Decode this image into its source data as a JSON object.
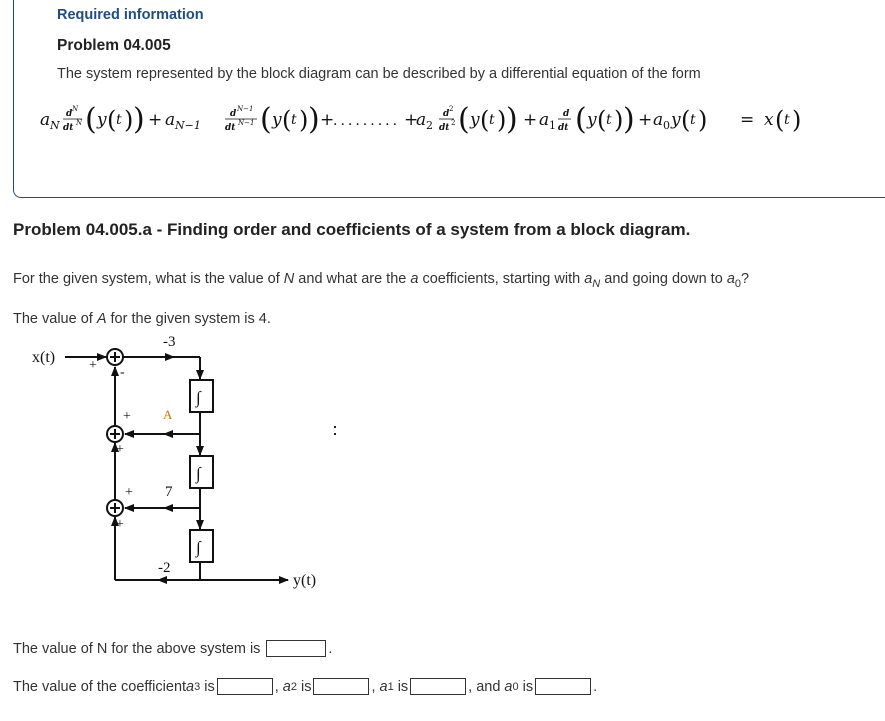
{
  "header": {
    "required_info": "Required information",
    "problem_title": "Problem 04.005",
    "description": "The system represented by the block diagram can be described by a differential equation of the form"
  },
  "equation": {
    "latex": "a_N d^N/dt^N (y(t)) + a_{N-1} d^{N-1}/dt^{N-1} (y(t)) + ......... + a_2 d^2/dt^2 (y(t)) + a_1 d/dt (y(t)) + a_0 y(t) = x(t)",
    "aN": "a",
    "aN_sub": "N",
    "dN_num": "d",
    "dN_num_sup": "N",
    "dN_den": "dt",
    "dN_den_sup": "N",
    "y_of_t": "y",
    "t": "t",
    "plus": "+",
    "aN1": "a",
    "aN1_sub": "N−1",
    "dN1_sup": "N−1",
    "dots": ".........",
    "a2": "a",
    "a2_sub": "2",
    "d2_sup": "2",
    "a1": "a",
    "a1_sub": "1",
    "a0": "a",
    "a0_sub": "0",
    "d": "d",
    "dt": "dt",
    "equals": "=",
    "x": "x"
  },
  "subproblem": {
    "heading": "Problem 04.005.a - Finding order and coefficients of a system from a block diagram.",
    "question_part1": "For the given system, what is the value of ",
    "question_N": "N",
    "question_part2": " and what are the ",
    "question_a": "a",
    "question_part3": " coefficients, starting with ",
    "question_aN": "a",
    "question_aN_sub": "N",
    "question_part4": " and going down to ",
    "question_a0": "a",
    "question_a0_sub": "0",
    "question_end": "?",
    "a_value_part1": "The value of ",
    "a_value_A": "A",
    "a_value_part2": " for the given system is 4."
  },
  "diagram": {
    "input_label": "x(t)",
    "output_label": "y(t)",
    "gain_top": "-3",
    "gain_A": "A",
    "gain_7": "7",
    "gain_bottom": "-2",
    "integrator_symbol": "∫",
    "plus_sign": "+",
    "minus_sign": "-",
    "accent_color": "#c77a00"
  },
  "answers": {
    "n_label": "The value of N for the above system is",
    "n_value": "",
    "n_end": ".",
    "coef_label": "The value of the coefficient ",
    "a3": "a",
    "a3_sub": "3",
    "is": "is",
    "a3_value": "",
    "sep": ",",
    "a2": "a",
    "a2_sub": "2",
    "a2_value": "",
    "a1": "a",
    "a1_sub": "1",
    "a1_value": "",
    "and": ", and",
    "a0": "a",
    "a0_sub": "0",
    "a0_value": "",
    "end": "."
  }
}
